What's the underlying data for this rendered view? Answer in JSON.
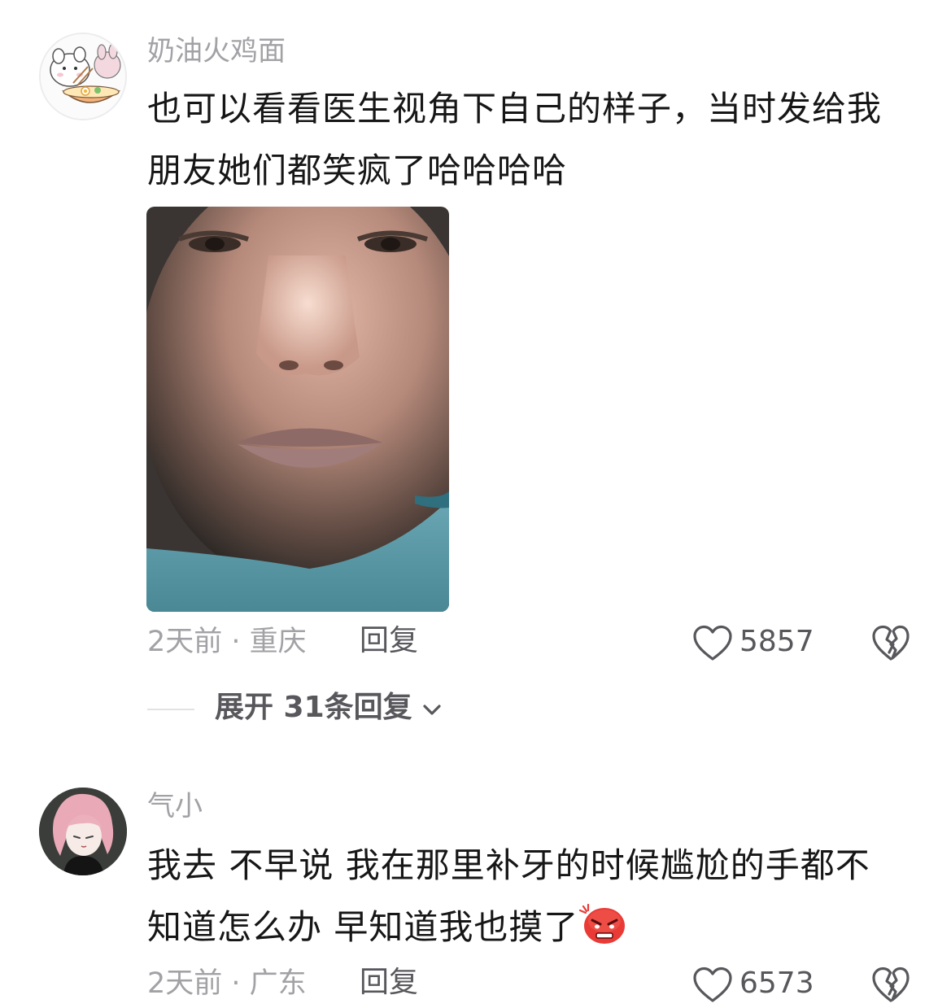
{
  "comments": [
    {
      "username": "奶油火鸡面",
      "avatar_icon": "cartoon-bunny-ramen-avatar",
      "text_line1": "也可以看看医生视角下自己的样子，当时发给我",
      "text_line2": "朋友她们都笑疯了哈哈哈哈",
      "image_icon": "face-selfie-photo",
      "time_location": "2天前 · 重庆",
      "reply_label": "回复",
      "like_count": "5857",
      "like_icon": "heart-outline-icon",
      "dislike_icon": "broken-heart-icon",
      "expand_label": "展开 31条回复",
      "expand_icon": "chevron-down-icon"
    },
    {
      "username": "气小",
      "avatar_icon": "anime-pink-hair-avatar",
      "text_line1": "我去 不早说 我在那里补牙的时候尴尬的手都不",
      "text_line2": "知道怎么办 早知道我也摸了",
      "emoji_icon": "angry-face-emoji-icon",
      "time_location": "2天前 · 广东",
      "reply_label": "回复",
      "like_count": "6573",
      "like_icon": "heart-outline-icon",
      "dislike_icon": "broken-heart-icon"
    }
  ],
  "colors": {
    "text_primary": "#161616",
    "text_secondary": "#a2a2a6",
    "action": "#57575c",
    "divider": "#e2e2e5"
  }
}
